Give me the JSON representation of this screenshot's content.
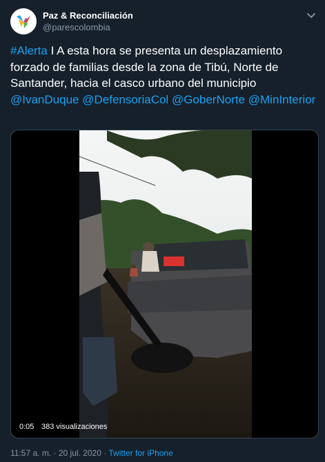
{
  "account": {
    "name": "Paz & Reconciliación",
    "handle": "@parescolombia"
  },
  "tweet": {
    "hashtag": "#Alerta",
    "body": " I A esta hora se presenta un desplazamiento forzado de familias desde la zona de Tibú, Norte de Santander, hacia el casco urbano del municipio ",
    "mentions": [
      "@IvanDuque",
      "@DefensoriaCol",
      "@GoberNorte",
      "@MinInterior"
    ]
  },
  "video": {
    "elapsed": "0:05",
    "views": "383 visualizaciones"
  },
  "meta": {
    "time": "11:57 a. m.",
    "separator": "·",
    "date": "20 jul. 2020",
    "source": "Twitter for iPhone"
  },
  "colors": {
    "background": "#15202b",
    "link": "#1da1f2",
    "secondary_text": "#8899a6"
  },
  "icons": [
    "avatar-logo-icon",
    "chevron-down-icon"
  ]
}
